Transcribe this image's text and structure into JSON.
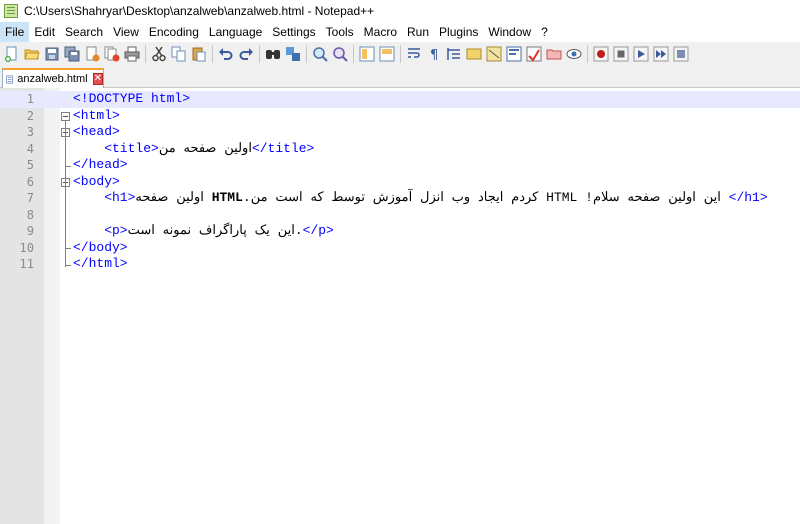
{
  "window": {
    "title": "C:\\Users\\Shahryar\\Desktop\\anzalweb\\anzalweb.html - Notepad++"
  },
  "menu": [
    "File",
    "Edit",
    "Search",
    "View",
    "Encoding",
    "Language",
    "Settings",
    "Tools",
    "Macro",
    "Run",
    "Plugins",
    "Window",
    "?"
  ],
  "toolbar": {
    "icons": [
      "new-file-icon",
      "open-file-icon",
      "save-icon",
      "save-all-icon",
      "close-icon",
      "close-all-icon",
      "print-icon",
      "cut-icon",
      "copy-icon",
      "paste-icon",
      "undo-icon",
      "redo-icon",
      "find-icon",
      "replace-icon",
      "zoom-in-icon",
      "zoom-out-icon",
      "sync-vertical-icon",
      "sync-horizontal-icon",
      "word-wrap-icon",
      "show-all-chars-icon",
      "indent-guide-icon",
      "user-lang-icon",
      "doc-map-icon",
      "function-list-icon",
      "folder-workspace-icon",
      "monitoring-icon",
      "record-macro-icon",
      "stop-record-icon",
      "play-macro-icon",
      "run-macro-multiple-icon",
      "save-macro-icon"
    ]
  },
  "tab": {
    "label": "anzalweb.html",
    "close": "✕"
  },
  "editor": {
    "lines": [
      {
        "no": "1",
        "tag1": "<!DOCTYPE html>"
      },
      {
        "no": "2",
        "tag1": "<html>"
      },
      {
        "no": "3",
        "tag1": "<head>"
      },
      {
        "no": "4",
        "tag1": "    <title>",
        "text": "اولین صفحه من",
        "tag2": "</title>"
      },
      {
        "no": "5",
        "tag1": "</head>"
      },
      {
        "no": "6",
        "tag1": "<body>"
      },
      {
        "no": "7",
        "tag1": "    <h1>",
        "text_pre": "اولین صفحه",
        "bold": "HTML",
        "text": " این اولین صفحه سلام! HTML کردم ایجاد وب انزل آموزش توسط که است من.",
        "tag2": "</h1>"
      },
      {
        "no": "8",
        "tag1": ""
      },
      {
        "no": "9",
        "tag1": "    <p>",
        "text": ".این یک پاراگراف نمونه است",
        "tag2": "</p>"
      },
      {
        "no": "10",
        "tag1": "</body>"
      },
      {
        "no": "11",
        "tag1": "</html>"
      }
    ]
  },
  "colors": {
    "tag": "#0000ff",
    "current_line": "#e8e8ff",
    "gutter": "#e4e4e4"
  }
}
